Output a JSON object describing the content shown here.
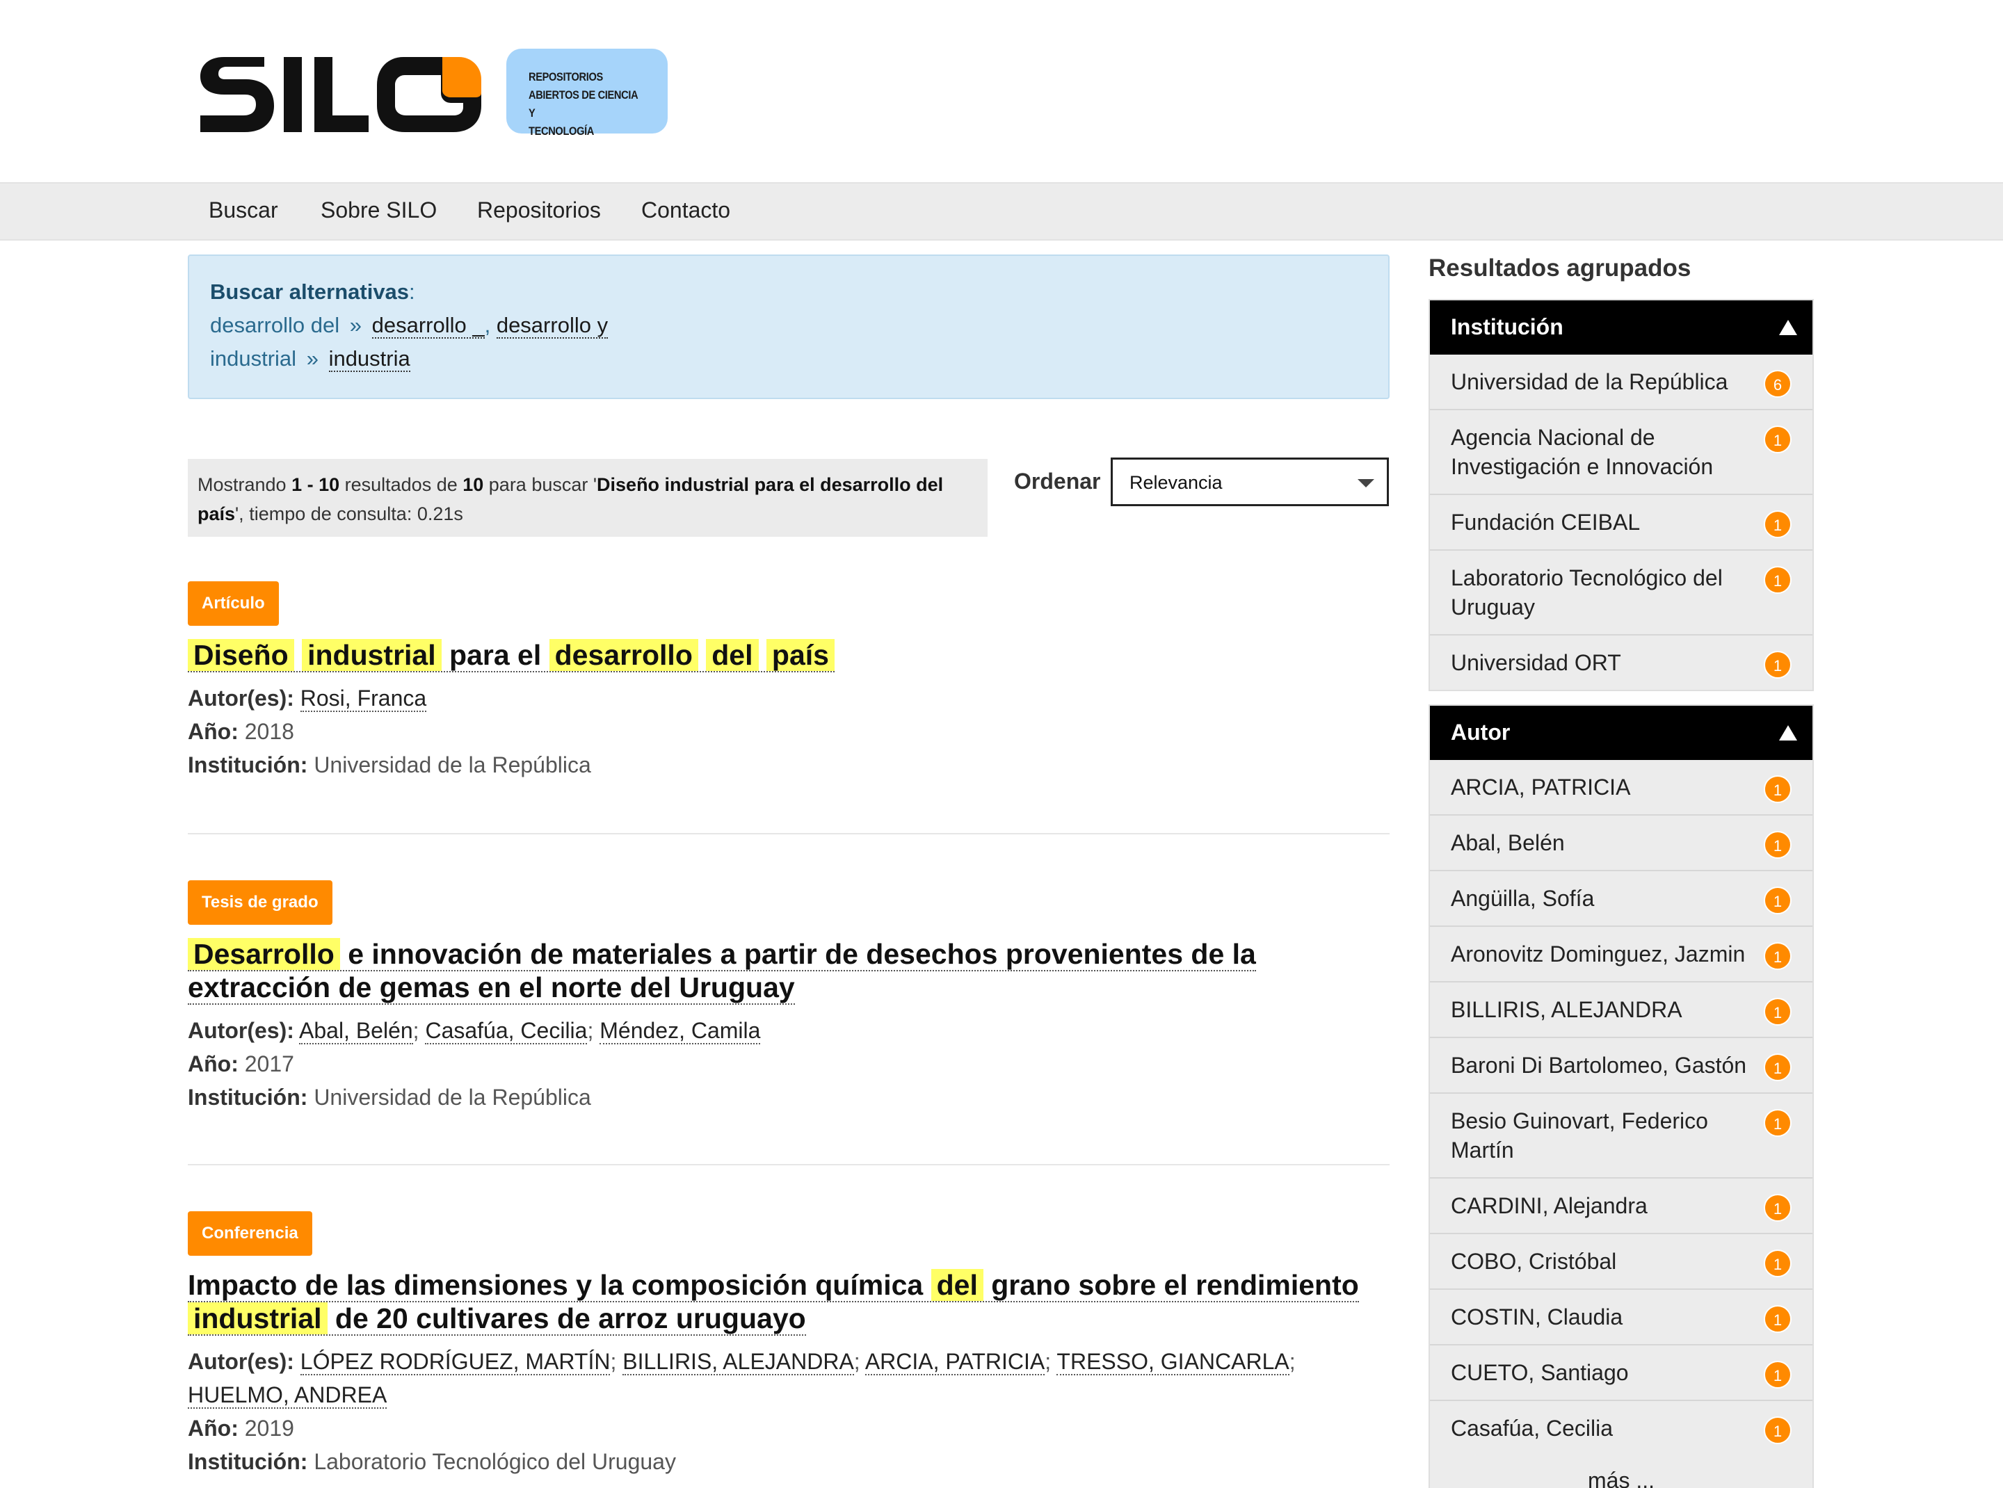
{
  "brand": {
    "name": "SILO",
    "tagline": "REPOSITORIOS\nABIERTOS DE CIENCIA Y\nTECNOLOGÍA",
    "accent": "#ff8a00",
    "tagline_bg": "#a6d4fa"
  },
  "nav": [
    "Buscar",
    "Sobre SILO",
    "Repositorios",
    "Contacto"
  ],
  "alternatives": {
    "title": "Buscar alternativas",
    "term1": "desarrollo del",
    "term1_links": [
      "desarrollo _",
      "desarrollo y"
    ],
    "term2": "industrial",
    "term2_links": [
      "industria"
    ]
  },
  "summary": {
    "pre": "Mostrando ",
    "range": "1 - 10",
    "mid": " resultados de ",
    "total": "10",
    "mid2": " para buscar '",
    "query": "Diseño industrial para el desarrollo del país",
    "post": "', tiempo de consulta: 0.21s"
  },
  "sort": {
    "label": "Ordenar",
    "selected": "Relevancia"
  },
  "labels": {
    "authors": "Autor(es):",
    "year": "Año:",
    "institution": "Institución:"
  },
  "results": [
    {
      "type": "Artículo",
      "title_parts": [
        {
          "t": "Diseño",
          "h": true
        },
        {
          "t": " ",
          "h": false
        },
        {
          "t": "industrial",
          "h": true
        },
        {
          "t": " para el ",
          "h": false
        },
        {
          "t": "desarrollo",
          "h": true
        },
        {
          "t": " ",
          "h": false
        },
        {
          "t": "del",
          "h": true
        },
        {
          "t": " ",
          "h": false
        },
        {
          "t": "país",
          "h": true
        }
      ],
      "authors": [
        "Rosi, Franca"
      ],
      "year": "2018",
      "institution": "Universidad de la República"
    },
    {
      "type": "Tesis de grado",
      "title_parts": [
        {
          "t": "Desarrollo",
          "h": true
        },
        {
          "t": " e innovación de materiales a partir de desechos provenientes de la extracción de gemas en el norte del Uruguay",
          "h": false
        }
      ],
      "authors": [
        "Abal, Belén",
        "Casafúa, Cecilia",
        "Méndez, Camila"
      ],
      "year": "2017",
      "institution": "Universidad de la República"
    },
    {
      "type": "Conferencia",
      "title_parts": [
        {
          "t": "Impacto de las dimensiones y la composición química ",
          "h": false
        },
        {
          "t": "del",
          "h": true
        },
        {
          "t": " grano sobre el rendimiento ",
          "h": false
        },
        {
          "t": "industrial",
          "h": true
        },
        {
          "t": " de 20 cultivares de arroz uruguayo",
          "h": false
        }
      ],
      "authors": [
        "LÓPEZ RODRÍGUEZ, MARTÍN",
        "BILLIRIS, ALEJANDRA",
        "ARCIA, PATRICIA",
        "TRESSO, GIANCARLA",
        "HUELMO, ANDREA"
      ],
      "year": "2019",
      "institution": "Laboratorio Tecnológico del Uruguay"
    }
  ],
  "sidebar": {
    "title": "Resultados agrupados",
    "facets": [
      {
        "name": "Institución",
        "items": [
          {
            "label": "Universidad de la República",
            "count": "6"
          },
          {
            "label": "Agencia Nacional de Investigación e Innovación",
            "count": "1"
          },
          {
            "label": "Fundación CEIBAL",
            "count": "1"
          },
          {
            "label": "Laboratorio Tecnológico del Uruguay",
            "count": "1"
          },
          {
            "label": "Universidad ORT",
            "count": "1"
          }
        ]
      },
      {
        "name": "Autor",
        "items": [
          {
            "label": "ARCIA, PATRICIA",
            "count": "1"
          },
          {
            "label": "Abal, Belén",
            "count": "1"
          },
          {
            "label": "Angüilla, Sofía",
            "count": "1"
          },
          {
            "label": "Aronovitz Dominguez, Jazmin",
            "count": "1"
          },
          {
            "label": "BILLIRIS, ALEJANDRA",
            "count": "1"
          },
          {
            "label": "Baroni Di Bartolomeo, Gastón",
            "count": "1"
          },
          {
            "label": "Besio Guinovart, Federico Martín",
            "count": "1"
          },
          {
            "label": "CARDINI, Alejandra",
            "count": "1"
          },
          {
            "label": "COBO, Cristóbal",
            "count": "1"
          },
          {
            "label": "COSTIN, Claudia",
            "count": "1"
          },
          {
            "label": "CUETO, Santiago",
            "count": "1"
          },
          {
            "label": "Casafúa, Cecilia",
            "count": "1"
          }
        ],
        "more": "más ..."
      }
    ]
  }
}
